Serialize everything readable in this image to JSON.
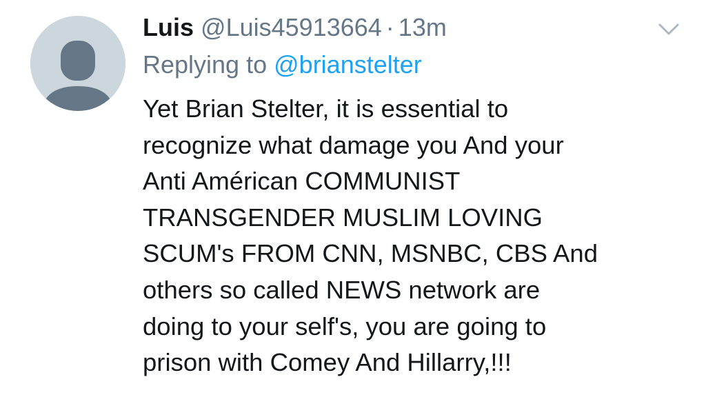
{
  "tweet": {
    "display_name": "Luis",
    "handle": "@Luis45913664",
    "separator": "·",
    "time": "13m",
    "reply_prefix": "Replying to",
    "reply_handle": "@brianstelter",
    "body_lines": [
      "Yet Brian Stelter, it is essential to",
      "recognize what damage you And your",
      "Anti Américan COMMUNIST",
      "TRANSGENDER MUSLIM LOVING",
      "SCUM's FROM CNN, MSNBC, CBS And",
      "others so called NEWS network are",
      "doing to your self's, you are going to",
      "prison with Comey And Hillarry,!!!"
    ],
    "avatar_icon": "default-profile-silhouette-icon",
    "menu_icon": "chevron-down-icon"
  },
  "colors": {
    "name": "#14171a",
    "secondary": "#657786",
    "link": "#1da1f2",
    "avatar_bg": "#ccd6dd",
    "avatar_silhouette": "#657786",
    "chevron": "#aab8c2"
  }
}
